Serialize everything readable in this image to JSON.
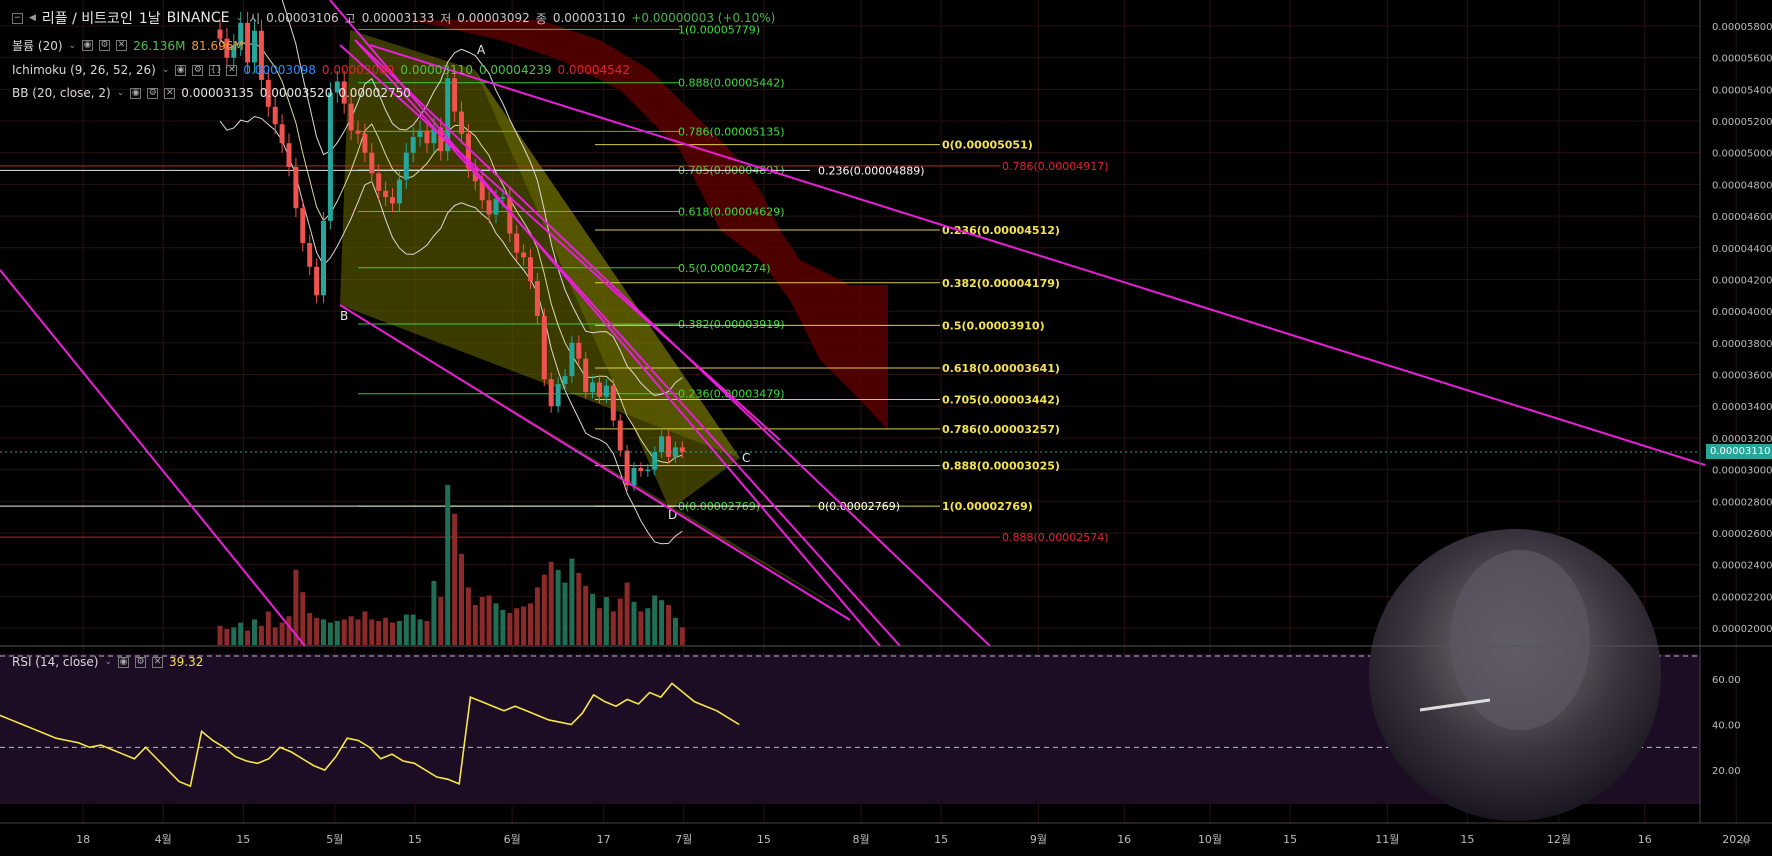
{
  "header": {
    "symbol": "리플 / 비트코인",
    "interval": "1날",
    "exchange": "BINANCE",
    "open_label": "시",
    "open": "0.00003106",
    "high_label": "고",
    "high": "0.00003133",
    "low_label": "저",
    "low": "0.00003092",
    "close_label": "종",
    "close": "0.00003110",
    "change": "+0.00000003 (+0.10%)"
  },
  "indicators": {
    "volume": {
      "label": "볼륨 (20)",
      "v1": "26.136M",
      "v2": "81.696M"
    },
    "ichimoku": {
      "label": "Ichimoku (9, 26, 52, 26)",
      "v1": "0.00003098",
      "v2": "0.00003080",
      "v3": "0.00003110",
      "v4": "0.00004239",
      "v5": "0.00004542"
    },
    "bb": {
      "label": "BB (20, close, 2)",
      "v1": "0.00003135",
      "v2": "0.00003520",
      "v3": "0.00002750"
    },
    "rsi": {
      "label": "RSI (14, close)",
      "value": "39.32"
    }
  },
  "current_price_tag": "0.00003110",
  "colors": {
    "up": "#26a69a",
    "down": "#ef5350",
    "magenta": "#e81ed8",
    "fib_green": "#3ddc3d",
    "fib_yellow": "#f3e34f",
    "fib_red": "#e0222d",
    "rsi_line": "#f5e64a",
    "cloud": "#5a0000"
  },
  "chart_data": {
    "type": "candlestick",
    "y_axis": {
      "min": 1.88e-05,
      "max": 5.9e-05,
      "ticks": [
        "0.00005800",
        "0.00005600",
        "0.00005400",
        "0.00005200",
        "0.00005000",
        "0.00004800",
        "0.00004600",
        "0.00004400",
        "0.00004200",
        "0.00004000",
        "0.00003800",
        "0.00003600",
        "0.00003400",
        "0.00003200",
        "0.00003000",
        "0.00002800",
        "0.00002600",
        "0.00002400",
        "0.00002200",
        "0.00002000"
      ]
    },
    "x_axis": {
      "ticks": [
        {
          "label": "18",
          "day": -47
        },
        {
          "label": "4월",
          "day": -33
        },
        {
          "label": "15",
          "day": -19
        },
        {
          "label": "5월",
          "day": -3
        },
        {
          "label": "15",
          "day": 11
        },
        {
          "label": "6월",
          "day": 28
        },
        {
          "label": "17",
          "day": 44
        },
        {
          "label": "7월",
          "day": 58
        },
        {
          "label": "15",
          "day": 72
        },
        {
          "label": "8월",
          "day": 89
        },
        {
          "label": "15",
          "day": 103
        },
        {
          "label": "9월",
          "day": 120
        },
        {
          "label": "16",
          "day": 135
        },
        {
          "label": "10월",
          "day": 150
        },
        {
          "label": "15",
          "day": 164
        },
        {
          "label": "11월",
          "day": 181
        },
        {
          "label": "15",
          "day": 195
        },
        {
          "label": "12월",
          "day": 211
        },
        {
          "label": "16",
          "day": 226
        },
        {
          "label": "2020",
          "day": 242
        }
      ]
    },
    "close": [
      5.72e-05,
      5.6e-05,
      5.68e-05,
      5.82e-05,
      5.57e-05,
      5.77e-05,
      5.46e-05,
      5.29e-05,
      5.18e-05,
      5.06e-05,
      4.91e-05,
      4.65e-05,
      4.43e-05,
      4.28e-05,
      4.1e-05,
      4.57e-05,
      5.38e-05,
      5.45e-05,
      5.31e-05,
      5.14e-05,
      5.12e-05,
      5e-05,
      4.87e-05,
      4.76e-05,
      4.72e-05,
      4.68e-05,
      4.83e-05,
      5e-05,
      5.1e-05,
      5.14e-05,
      5.06e-05,
      5.16e-05,
      5.01e-05,
      5.47e-05,
      5.26e-05,
      5.12e-05,
      4.9e-05,
      4.82e-05,
      4.7e-05,
      4.61e-05,
      4.71e-05,
      4.72e-05,
      4.49e-05,
      4.37e-05,
      4.34e-05,
      4.19e-05,
      3.97e-05,
      3.57e-05,
      3.4e-05,
      3.54e-05,
      3.59e-05,
      3.8e-05,
      3.7e-05,
      3.49e-05,
      3.55e-05,
      3.46e-05,
      3.53e-05,
      3.31e-05,
      3.12e-05,
      2.9e-05,
      3.01e-05,
      2.99e-05,
      3e-05,
      3.11e-05,
      3.21e-05,
      3.08e-05,
      3.14e-05,
      3.11e-05
    ],
    "volume_ratio": [
      0.12,
      0.1,
      0.11,
      0.14,
      0.09,
      0.16,
      0.12,
      0.21,
      0.11,
      0.14,
      0.18,
      0.47,
      0.33,
      0.2,
      0.17,
      0.16,
      0.14,
      0.15,
      0.16,
      0.18,
      0.16,
      0.21,
      0.16,
      0.15,
      0.17,
      0.14,
      0.15,
      0.19,
      0.19,
      0.16,
      0.15,
      0.4,
      0.3,
      1.0,
      0.82,
      0.57,
      0.36,
      0.25,
      0.3,
      0.31,
      0.26,
      0.22,
      0.2,
      0.23,
      0.24,
      0.26,
      0.36,
      0.44,
      0.52,
      0.47,
      0.39,
      0.54,
      0.45,
      0.37,
      0.32,
      0.23,
      0.3,
      0.21,
      0.29,
      0.39,
      0.27,
      0.21,
      0.23,
      0.31,
      0.28,
      0.25,
      0.17,
      0.11
    ],
    "rsi": {
      "ticks": [
        "60.00",
        "40.00",
        "20.00"
      ],
      "overbought": 70,
      "oversold": 30,
      "values": [
        44,
        42,
        40,
        38,
        36,
        34,
        33,
        32,
        30,
        31,
        29,
        27,
        25,
        30,
        25,
        20,
        15,
        13,
        37,
        33,
        30,
        26,
        24,
        23,
        25,
        30,
        28,
        25,
        22,
        20,
        26,
        34,
        33,
        30,
        25,
        27,
        24,
        23,
        20,
        17,
        16,
        14,
        52,
        50,
        48,
        46,
        48,
        46,
        44,
        42,
        41,
        40,
        45,
        53,
        50,
        48,
        51,
        49,
        54,
        52,
        58,
        54,
        50,
        48,
        46,
        43,
        40
      ]
    },
    "fibonacci": [
      {
        "label": "1(0.00005779)",
        "color": "green"
      },
      {
        "label": "0.888(0.00005442)",
        "color": "green"
      },
      {
        "label": "0.786(0.00005135)",
        "color": "green"
      },
      {
        "label": "0.705(0.00004891)",
        "color": "green"
      },
      {
        "label": "0.618(0.00004629)",
        "color": "green"
      },
      {
        "label": "0.5(0.00004274)",
        "color": "green"
      },
      {
        "label": "0.382(0.00003919)",
        "color": "green"
      },
      {
        "label": "0.236(0.00003479)",
        "color": "green"
      },
      {
        "label": "0(0.00002769)",
        "color": "green"
      },
      {
        "label": "0(0.00005051)",
        "color": "yellow"
      },
      {
        "label": "0.236(0.00004512)",
        "color": "yellow"
      },
      {
        "label": "0.382(0.00004179)",
        "color": "yellow"
      },
      {
        "label": "0.5(0.00003910)",
        "color": "yellow"
      },
      {
        "label": "0.618(0.00003641)",
        "color": "yellow"
      },
      {
        "label": "0.705(0.00003442)",
        "color": "yellow"
      },
      {
        "label": "0.786(0.00003257)",
        "color": "yellow"
      },
      {
        "label": "0.888(0.00003025)",
        "color": "yellow"
      },
      {
        "label": "1(0.00002769)",
        "color": "yellow"
      },
      {
        "label": "0.236(0.00004889)",
        "color": "white"
      },
      {
        "label": "0(0.00002769)",
        "color": "white"
      },
      {
        "label": "0.786(0.00004917)",
        "color": "red"
      },
      {
        "label": "0.888(0.00002574)",
        "color": "red"
      }
    ],
    "pattern_points": [
      "A",
      "B",
      "C",
      "D"
    ]
  }
}
